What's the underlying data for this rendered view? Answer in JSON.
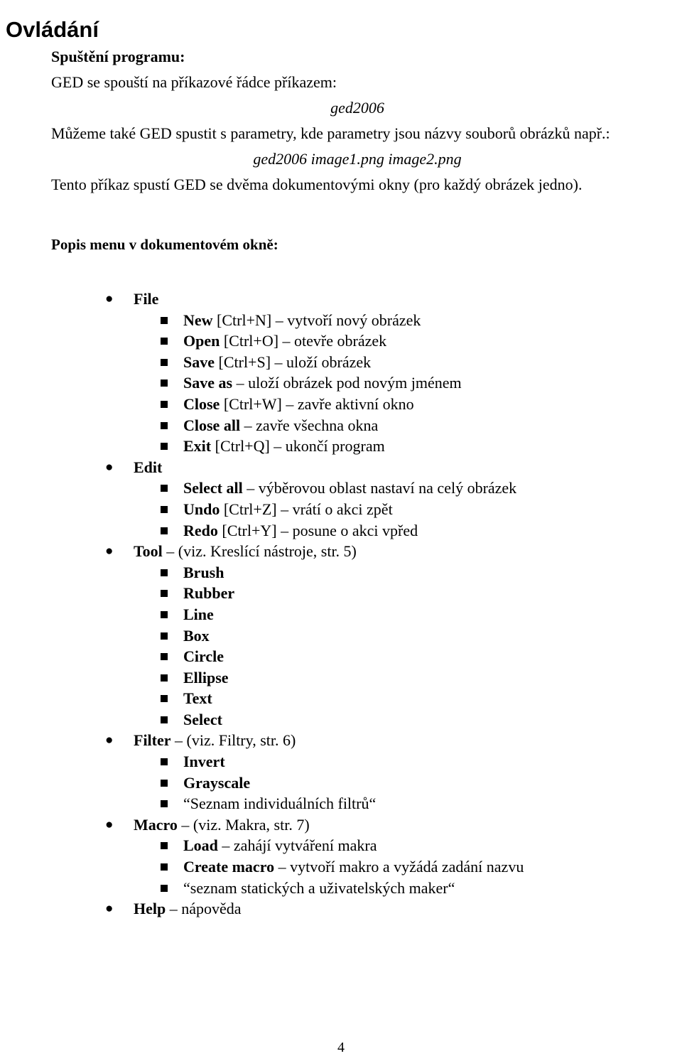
{
  "document": {
    "title": "Ovládání",
    "page_number": "4"
  },
  "intro": {
    "heading": "Spuštění programu:",
    "line1": "GED se spouští na příkazové řádce příkazem:",
    "command1": "ged2006",
    "line2": "Můžeme také GED spustit s parametry, kde parametry jsou názvy souborů obrázků např.:",
    "command2": "ged2006 image1.png image2.png",
    "line3": "Tento příkaz spustí GED se dvěma dokumentovými okny (pro každý obrázek jedno)."
  },
  "menu_section": {
    "heading": "Popis menu v dokumentovém okně:",
    "bullet_level1": "●",
    "bullet_level2": "■",
    "items": [
      {
        "level": 1,
        "label": "File",
        "desc": ""
      },
      {
        "level": 2,
        "label": "New",
        "desc": " [Ctrl+N] – vytvoří nový obrázek"
      },
      {
        "level": 2,
        "label": "Open",
        "desc": " [Ctrl+O] – otevře obrázek"
      },
      {
        "level": 2,
        "label": "Save",
        "desc": " [Ctrl+S] – uloží obrázek"
      },
      {
        "level": 2,
        "label": "Save as",
        "desc": " – uloží obrázek pod novým jménem"
      },
      {
        "level": 2,
        "label": "Close",
        "desc": " [Ctrl+W] – zavře aktivní okno"
      },
      {
        "level": 2,
        "label": "Close all",
        "desc": " – zavře všechna okna"
      },
      {
        "level": 2,
        "label": "Exit",
        "desc": " [Ctrl+Q] – ukončí program"
      },
      {
        "level": 1,
        "label": "Edit",
        "desc": ""
      },
      {
        "level": 2,
        "label": "Select all",
        "desc": " – výběrovou oblast nastaví na celý obrázek"
      },
      {
        "level": 2,
        "label": "Undo",
        "desc": " [Ctrl+Z] – vrátí o akci zpět"
      },
      {
        "level": 2,
        "label": "Redo",
        "desc": " [Ctrl+Y] – posune o akci vpřed"
      },
      {
        "level": 1,
        "label": "Tool",
        "desc": " – (viz. Kreslící nástroje, str. 5)"
      },
      {
        "level": 2,
        "label": "Brush",
        "desc": ""
      },
      {
        "level": 2,
        "label": "Rubber",
        "desc": ""
      },
      {
        "level": 2,
        "label": "Line",
        "desc": ""
      },
      {
        "level": 2,
        "label": "Box",
        "desc": ""
      },
      {
        "level": 2,
        "label": "Circle",
        "desc": ""
      },
      {
        "level": 2,
        "label": "Ellipse",
        "desc": ""
      },
      {
        "level": 2,
        "label": "Text",
        "desc": ""
      },
      {
        "level": 2,
        "label": "Select",
        "desc": ""
      },
      {
        "level": 1,
        "label": "Filter",
        "desc": " – (viz. Filtry, str. 6)"
      },
      {
        "level": 2,
        "label": "Invert",
        "desc": ""
      },
      {
        "level": 2,
        "label": "Grayscale",
        "desc": ""
      },
      {
        "level": 2,
        "label": "",
        "desc": "“Seznam individuálních filtrů“"
      },
      {
        "level": 1,
        "label": "Macro",
        "desc": " – (viz. Makra, str. 7)"
      },
      {
        "level": 2,
        "label": "Load",
        "desc": " – zahájí vytváření makra"
      },
      {
        "level": 2,
        "label": "Create macro",
        "desc": " – vytvoří makro a vyžádá zadání nazvu"
      },
      {
        "level": 2,
        "label": "",
        "desc": "“seznam statických a uživatelských maker“"
      },
      {
        "level": 1,
        "label": "Help",
        "desc": " – nápověda"
      }
    ]
  }
}
